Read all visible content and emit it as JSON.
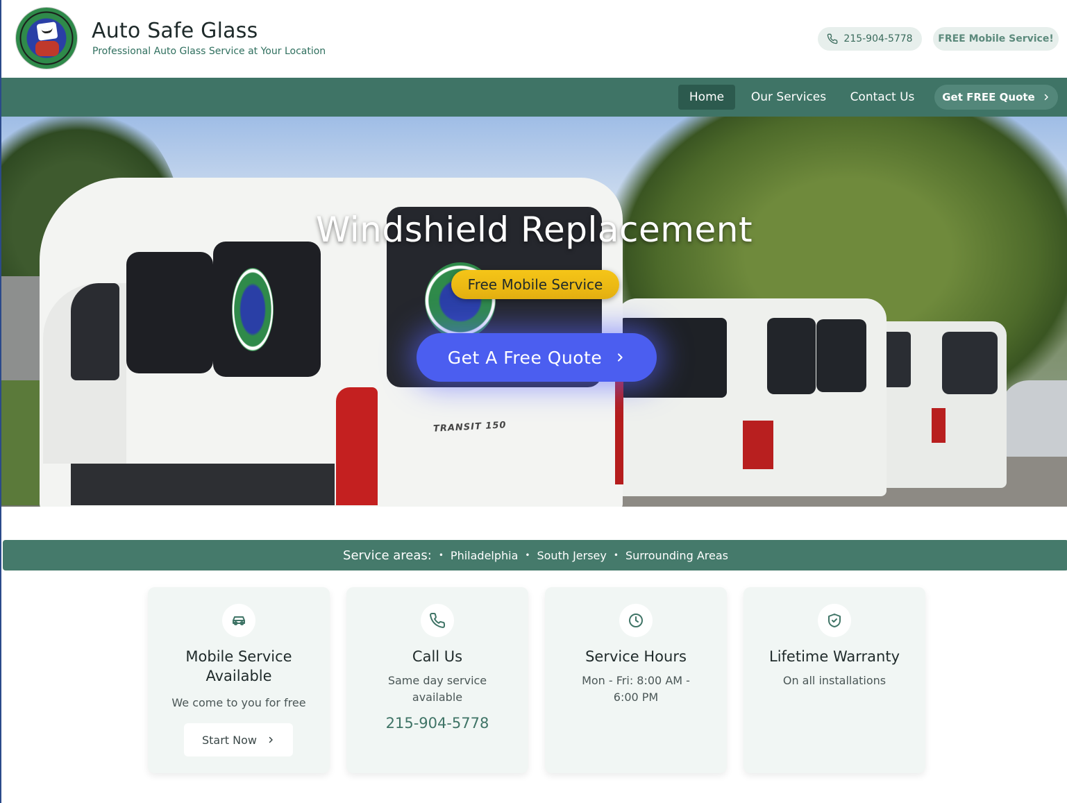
{
  "header": {
    "brand_title": "Auto Safe Glass",
    "brand_subtitle": "Professional Auto Glass Service at Your Location",
    "phone": "215-904-5778",
    "free_badge": "FREE Mobile Service!"
  },
  "nav": {
    "items": [
      {
        "label": "Home",
        "active": true
      },
      {
        "label": "Our Services"
      },
      {
        "label": "Contact Us"
      }
    ],
    "quote_button": "Get FREE Quote"
  },
  "hero": {
    "title": "Windshield Replacement",
    "badge": "Free Mobile Service",
    "cta": "Get A Free Quote",
    "van_model": "TRANSIT 150"
  },
  "service_areas": {
    "label": "Service areas:",
    "areas": [
      "Philadelphia",
      "South Jersey",
      "Surrounding Areas"
    ]
  },
  "cards": [
    {
      "icon": "car-icon",
      "title": "Mobile Service Available",
      "desc": "We come to you for free",
      "button": "Start Now"
    },
    {
      "icon": "phone-icon",
      "title": "Call Us",
      "desc": "Same day service available",
      "phone": "215-904-5778"
    },
    {
      "icon": "clock-icon",
      "title": "Service Hours",
      "desc": "Mon - Fri: 8:00 AM - 6:00 PM"
    },
    {
      "icon": "shield-check-icon",
      "title": "Lifetime Warranty",
      "desc": "On all installations"
    }
  ],
  "colors": {
    "primary_green": "#3f7466",
    "bar_green": "#457a6b",
    "cta_blue": "#4b5ef0",
    "badge_yellow": "#f5c518"
  }
}
